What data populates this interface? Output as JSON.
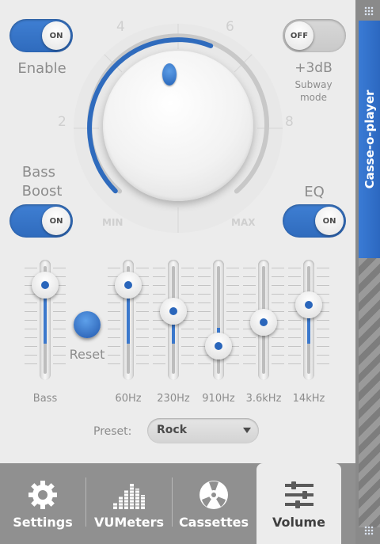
{
  "toggles": {
    "enable": {
      "state": "ON",
      "label": "Enable"
    },
    "subway": {
      "state": "OFF",
      "label": "+3dB",
      "sublabel1": "Subway",
      "sublabel2": "mode"
    },
    "bass_boost": {
      "state": "ON",
      "label1": "Bass",
      "label2": "Boost"
    },
    "eq": {
      "state": "ON",
      "label": "EQ"
    }
  },
  "volume_knob": {
    "scale": [
      "2",
      "4",
      "6",
      "8"
    ],
    "min_label": "MIN",
    "max_label": "MAX",
    "level_fraction": 0.58
  },
  "bass_slider": {
    "label": "Bass",
    "level": 0.82
  },
  "reset_label": "Reset",
  "eq_bands": [
    {
      "label": "60Hz",
      "level": 0.82
    },
    {
      "label": "230Hz",
      "level": 0.58
    },
    {
      "label": "910Hz",
      "level": 0.26
    },
    {
      "label": "3.6kHz",
      "level": 0.48
    },
    {
      "label": "14kHz",
      "level": 0.64
    }
  ],
  "preset": {
    "label": "Preset:",
    "value": "Rock"
  },
  "tabs": [
    {
      "label": "Settings",
      "icon": "gear-icon",
      "active": false
    },
    {
      "label": "VUMeters",
      "icon": "vu-meter-icon",
      "active": false
    },
    {
      "label": "Cassettes",
      "icon": "cassette-reel-icon",
      "active": false
    },
    {
      "label": "Volume",
      "icon": "equalizer-sliders-icon",
      "active": true
    }
  ],
  "app_title": "Casse-o-player",
  "colors": {
    "accent": "#2f6bbd",
    "background": "#ececec",
    "tabbar": "#909090"
  }
}
